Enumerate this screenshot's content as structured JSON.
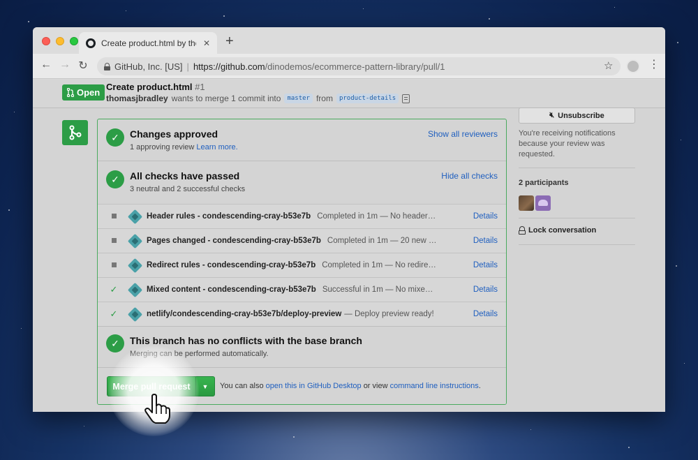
{
  "browser": {
    "tab_title": "Create product.html by thomasjbradley",
    "new_tab_symbol": "+",
    "site_identity": "GitHub, Inc. [US]",
    "url_host": "https://github.com",
    "url_path": "/dinodemos/ecommerce-pattern-library/pull/1"
  },
  "pr": {
    "status_label": "Open",
    "title": "Create product.html",
    "number": "#1",
    "author": "thomasjbradley",
    "merge_text": "wants to merge 1 commit into",
    "base_branch": "master",
    "from_text": "from",
    "head_branch": "product-details"
  },
  "approval": {
    "title": "Changes approved",
    "subtitle": "1 approving review",
    "learn_more": "Learn more.",
    "action": "Show all reviewers"
  },
  "checks": {
    "title": "All checks have passed",
    "subtitle": "3 neutral and 2 successful checks",
    "action": "Hide all checks",
    "rows": [
      {
        "status": "neutral",
        "name": "Header rules - condescending-cray-b53e7b",
        "desc": "Completed in 1m — No header…",
        "details": "Details"
      },
      {
        "status": "neutral",
        "name": "Pages changed - condescending-cray-b53e7b",
        "desc": "Completed in 1m — 20 new …",
        "details": "Details"
      },
      {
        "status": "neutral",
        "name": "Redirect rules - condescending-cray-b53e7b",
        "desc": "Completed in 1m — No redire…",
        "details": "Details"
      },
      {
        "status": "success",
        "name": "Mixed content - condescending-cray-b53e7b",
        "desc": "Successful in 1m — No mixe…",
        "details": "Details"
      },
      {
        "status": "success",
        "name": "netlify/condescending-cray-b53e7b/deploy-preview",
        "desc": "— Deploy preview ready!",
        "details": "Details"
      }
    ]
  },
  "conflicts": {
    "title": "This branch has no conflicts with the base branch",
    "subtitle": "Merging can be performed automatically."
  },
  "merge": {
    "button_label": "Merge pull request",
    "note_prefix": "You can also",
    "desktop_link": "open this in GitHub Desktop",
    "note_mid": "or view",
    "cli_link": "command line instructions",
    "note_suffix": "."
  },
  "sidebar": {
    "unsubscribe_label": "Unsubscribe",
    "notification_text": "You're receiving notifications because your review was requested.",
    "participants_label": "2 participants",
    "lock_label": "Lock conversation"
  },
  "colors": {
    "green": "#2c9d46",
    "link_blue": "#1f5fbf"
  }
}
